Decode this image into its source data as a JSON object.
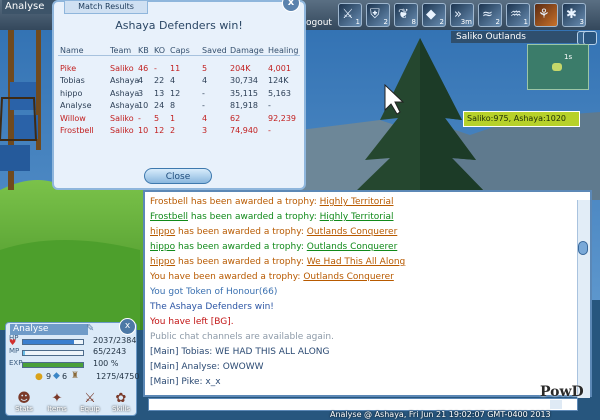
{
  "top": {
    "player_name": "Analyse",
    "logout_label": "ogout",
    "ability_bar": [
      {
        "icon": "sword-icon",
        "count": "1"
      },
      {
        "icon": "shield-icon",
        "count": "2"
      },
      {
        "icon": "paw-icon",
        "count": "8"
      },
      {
        "icon": "crystal-icon",
        "count": "2"
      },
      {
        "icon": "sprint-icon",
        "count": "3m"
      },
      {
        "icon": "wind-icon",
        "count": "2"
      },
      {
        "icon": "water-icon",
        "count": "1"
      },
      {
        "icon": "claw-icon",
        "count": ""
      },
      {
        "icon": "star-icon",
        "count": "3"
      }
    ]
  },
  "match": {
    "tab": "Match Results",
    "title": "Ashaya Defenders win!",
    "columns": [
      "Name",
      "Team",
      "KB",
      "KO",
      "Caps",
      "Saved",
      "Damage",
      "Healing"
    ],
    "rows": [
      {
        "name": "Pike",
        "team": "Saliko",
        "kb": "46",
        "ko": "-",
        "caps": "11",
        "saved": "5",
        "damage": "204K",
        "healing": "4,001",
        "color": "#c22020"
      },
      {
        "name": "Tobias",
        "team": "Ashaya",
        "kb": "4",
        "ko": "22",
        "caps": "4",
        "saved": "4",
        "damage": "30,734",
        "healing": "124K",
        "color": "#2b3e55"
      },
      {
        "name": "hippo",
        "team": "Ashaya",
        "kb": "3",
        "ko": "13",
        "caps": "12",
        "saved": "-",
        "damage": "35,115",
        "healing": "5,163",
        "color": "#2b3e55"
      },
      {
        "name": "Analyse",
        "team": "Ashaya",
        "kb": "10",
        "ko": "24",
        "caps": "8",
        "saved": "-",
        "damage": "81,918",
        "healing": "-",
        "color": "#2b3e55"
      },
      {
        "name": "Willow",
        "team": "Saliko",
        "kb": "-",
        "ko": "5",
        "caps": "1",
        "saved": "4",
        "damage": "62",
        "healing": "92,239",
        "color": "#c22020"
      },
      {
        "name": "Frostbell",
        "team": "Saliko",
        "kb": "10",
        "ko": "12",
        "caps": "2",
        "saved": "3",
        "damage": "74,940",
        "healing": "-",
        "color": "#c22020"
      }
    ],
    "close_label": "Close",
    "close_x": "x"
  },
  "map": {
    "zone": "Saliko Outlands",
    "score": "Saliko:975, Ashaya:1020",
    "minimap_label": "1s"
  },
  "chat": {
    "lines": [
      {
        "parts": [
          {
            "t": "Frostbell",
            "c": "#b85a00",
            "u": false
          },
          {
            "t": " has been awarded a trophy: ",
            "c": "#b85a00",
            "u": false
          },
          {
            "t": "Highly Territorial",
            "c": "#b85a00",
            "u": true
          }
        ]
      },
      {
        "parts": [
          {
            "t": "Frostbell",
            "c": "#118a1a",
            "u": true
          },
          {
            "t": " has been awarded a trophy: ",
            "c": "#118a1a",
            "u": false
          },
          {
            "t": "Highly Territorial",
            "c": "#118a1a",
            "u": true
          }
        ]
      },
      {
        "parts": [
          {
            "t": "hippo",
            "c": "#b85a00",
            "u": true
          },
          {
            "t": " has been awarded a trophy: ",
            "c": "#b85a00",
            "u": false
          },
          {
            "t": "Outlands Conquerer",
            "c": "#b85a00",
            "u": true
          }
        ]
      },
      {
        "parts": [
          {
            "t": "hippo",
            "c": "#118a1a",
            "u": true
          },
          {
            "t": " has been awarded a trophy: ",
            "c": "#118a1a",
            "u": false
          },
          {
            "t": "Outlands Conquerer",
            "c": "#118a1a",
            "u": true
          }
        ]
      },
      {
        "parts": [
          {
            "t": "hippo",
            "c": "#b85a00",
            "u": true
          },
          {
            "t": " has been awarded a trophy: ",
            "c": "#b85a00",
            "u": false
          },
          {
            "t": "We Had This All Along",
            "c": "#b85a00",
            "u": true
          }
        ]
      },
      {
        "parts": [
          {
            "t": "You have been awarded a trophy: ",
            "c": "#b85a00",
            "u": false
          },
          {
            "t": "Outlands Conquerer",
            "c": "#b85a00",
            "u": true
          }
        ]
      },
      {
        "parts": [
          {
            "t": "You got Token of Honour(66)",
            "c": "#3a70b0",
            "u": false
          }
        ]
      },
      {
        "parts": [
          {
            "t": "The Ashaya Defenders win!",
            "c": "#2b55a4",
            "u": false
          }
        ]
      },
      {
        "parts": [
          {
            "t": "You have left [BG].",
            "c": "#c21515",
            "u": false
          }
        ]
      },
      {
        "parts": [
          {
            "t": "Public chat channels are available again.",
            "c": "#8d9aa8",
            "u": false
          }
        ]
      },
      {
        "parts": [
          {
            "t": "[Main] Tobias: WE HAD THIS ALL ALONG",
            "c": "#2b4a73",
            "u": false
          }
        ]
      },
      {
        "parts": [
          {
            "t": "[Main] Analyse: OWOWW",
            "c": "#2b4a73",
            "u": false
          }
        ]
      },
      {
        "parts": [
          {
            "t": "[Main] Pike: x_x",
            "c": "#2b4a73",
            "u": false
          }
        ]
      }
    ],
    "input_value": ""
  },
  "char": {
    "name": "Analyse",
    "close_x": "x",
    "hp_label": "HP",
    "hp_text": "2037/2384",
    "hp_fraction": 0.854,
    "mp_label": "MP",
    "mp_text": "65/2243",
    "mp_fraction": 0.03,
    "exp_label": "EXP",
    "exp_text": "100 %",
    "exp_fraction": 1.0,
    "coins": "9",
    "gems": "6",
    "honour": "1275/4750",
    "buttons": [
      {
        "label": "Stats",
        "icon": "stats-icon",
        "glyph": "☻"
      },
      {
        "label": "Items",
        "icon": "items-icon",
        "glyph": "✦"
      },
      {
        "label": "Equip",
        "icon": "equip-icon",
        "glyph": "⚔"
      },
      {
        "label": "Skills",
        "icon": "skills-icon",
        "glyph": "✿"
      }
    ]
  },
  "status": "Analyse @ Ashaya, Fri Jun 21 19:02:07 GMT-0400 2013",
  "watermark": "PowD"
}
